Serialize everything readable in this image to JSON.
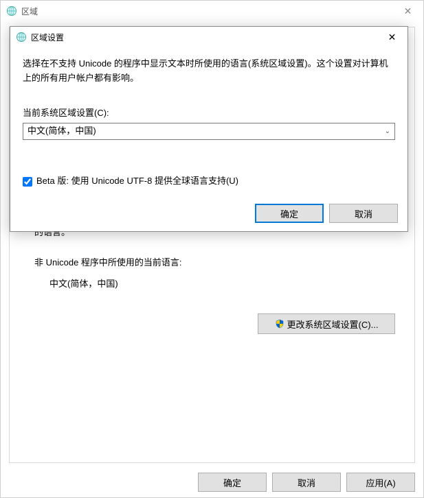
{
  "parent": {
    "title": "区域",
    "truncated_text": "的语言。",
    "section_label": "非 Unicode 程序中所使用的当前语言:",
    "section_value": "中文(简体，中国)",
    "change_button": "更改系统区域设置(C)...",
    "ok": "确定",
    "cancel": "取消",
    "apply": "应用(A)"
  },
  "modal": {
    "title": "区域设置",
    "description": "选择在不支持 Unicode 的程序中显示文本时所使用的语言(系统区域设置)。这个设置对计算机上的所有用户帐户都有影响。",
    "field_label": "当前系统区域设置(C):",
    "combo_value": "中文(简体，中国)",
    "checkbox_label": "Beta 版: 使用 Unicode UTF-8 提供全球语言支持(U)",
    "checkbox_checked": true,
    "ok": "确定",
    "cancel": "取消"
  }
}
